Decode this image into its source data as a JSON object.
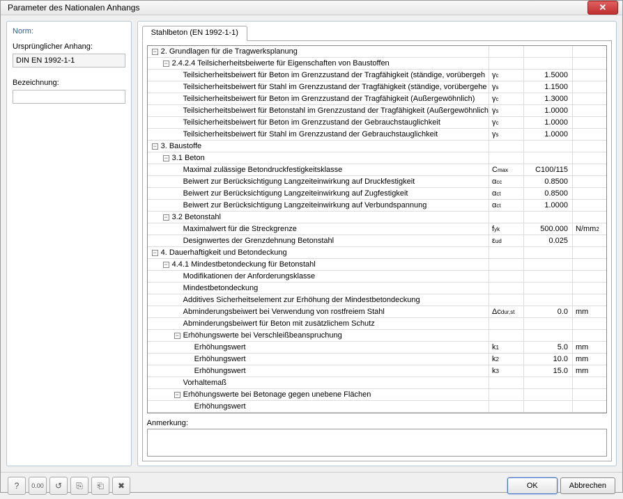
{
  "window": {
    "title": "Parameter des Nationalen Anhangs"
  },
  "left": {
    "norm_label": "Norm:",
    "ursprung_label": "Ursprünglicher Anhang:",
    "ursprung_value": "DIN EN 1992-1-1",
    "bezeichnung_label": "Bezeichnung:",
    "bezeichnung_value": ""
  },
  "tab": {
    "label": "Stahlbeton (EN 1992-1-1)"
  },
  "rows": [
    {
      "indent": 0,
      "toggle": "-",
      "desc": "2. Grundlagen für die Tragwerksplanung",
      "sym": "",
      "val": "",
      "unit": ""
    },
    {
      "indent": 1,
      "toggle": "-",
      "desc": "2.4.2.4 Teilsicherheitsbeiwerte für Eigenschaften von Baustoffen",
      "sym": "",
      "val": "",
      "unit": ""
    },
    {
      "indent": 2,
      "toggle": "",
      "desc": "Teilsicherheitsbeiwert für Beton im Grenzzustand der Tragfähigkeit (ständige, vorübergeh",
      "sym_html": "γ<sub>c</sub>",
      "val": "1.5000",
      "unit": ""
    },
    {
      "indent": 2,
      "toggle": "",
      "desc": "Teilsicherheitsbeiwert für Stahl im Grenzzustand der Tragfähigkeit (ständige, vorübergehe",
      "sym_html": "γ<sub>s</sub>",
      "val": "1.1500",
      "unit": ""
    },
    {
      "indent": 2,
      "toggle": "",
      "desc": "Teilsicherheitsbeiwert für Beton im Grenzzustand der Tragfähigkeit (Außergewöhnlich)",
      "sym_html": "γ<sub>c</sub>",
      "val": "1.3000",
      "unit": ""
    },
    {
      "indent": 2,
      "toggle": "",
      "desc": "Teilsicherheitsbeiwert für Betonstahl im Grenzzustand der Tragfähigkeit (Außergewöhnlich",
      "sym_html": "γ<sub>s</sub>",
      "val": "1.0000",
      "unit": ""
    },
    {
      "indent": 2,
      "toggle": "",
      "desc": "Teilsicherheitsbeiwert für Beton im Grenzzustand der Gebrauchstauglichkeit",
      "sym_html": "γ<sub>c</sub>",
      "val": "1.0000",
      "unit": ""
    },
    {
      "indent": 2,
      "toggle": "",
      "desc": "Teilsicherheitsbeiwert für Stahl im Grenzzustand der Gebrauchstauglichkeit",
      "sym_html": "γ<sub>s</sub>",
      "val": "1.0000",
      "unit": ""
    },
    {
      "indent": 0,
      "toggle": "-",
      "desc": "3. Baustoffe",
      "sym": "",
      "val": "",
      "unit": ""
    },
    {
      "indent": 1,
      "toggle": "-",
      "desc": "3.1 Beton",
      "sym": "",
      "val": "",
      "unit": ""
    },
    {
      "indent": 2,
      "toggle": "",
      "desc": "Maximal zulässige Betondruckfestigkeitsklasse",
      "sym_html": "C<sub>max</sub>",
      "val": "C100/115",
      "unit": ""
    },
    {
      "indent": 2,
      "toggle": "",
      "desc": "Beiwert zur Berücksichtigung Langzeiteinwirkung auf Druckfestigkeit",
      "sym_html": "α<sub>cc</sub>",
      "val": "0.8500",
      "unit": ""
    },
    {
      "indent": 2,
      "toggle": "",
      "desc": "Beiwert zur Berücksichtigung Langzeiteinwirkung auf Zugfestigkeit",
      "sym_html": "α<sub>ct</sub>",
      "val": "0.8500",
      "unit": ""
    },
    {
      "indent": 2,
      "toggle": "",
      "desc": "Beiwert zur Berücksichtigung Langzeiteinwirkung auf Verbundspannung",
      "sym_html": "α<sub>ct</sub>",
      "val": "1.0000",
      "unit": ""
    },
    {
      "indent": 1,
      "toggle": "-",
      "desc": "3.2 Betonstahl",
      "sym": "",
      "val": "",
      "unit": ""
    },
    {
      "indent": 2,
      "toggle": "",
      "desc": "Maximalwert für die Streckgrenze",
      "sym_html": "f<sub>yk</sub>",
      "val": "500.000",
      "unit_html": "N/mm<sup>2</sup>"
    },
    {
      "indent": 2,
      "toggle": "",
      "desc": "Designwertes der Grenzdehnung Betonstahl",
      "sym_html": "ε<sub>ud</sub>",
      "val": "0.025",
      "unit": ""
    },
    {
      "indent": 0,
      "toggle": "-",
      "desc": "4. Dauerhaftigkeit und Betondeckung",
      "sym": "",
      "val": "",
      "unit": ""
    },
    {
      "indent": 1,
      "toggle": "-",
      "desc": "4.4.1 Mindestbetondeckung für Betonstahl",
      "sym": "",
      "val": "",
      "unit": ""
    },
    {
      "indent": 2,
      "toggle": "",
      "desc": "Modifikationen der Anforderungsklasse",
      "sym": "",
      "val": "",
      "unit": ""
    },
    {
      "indent": 2,
      "toggle": "",
      "desc": "Mindestbetondeckung",
      "sym": "",
      "val": "",
      "unit": ""
    },
    {
      "indent": 2,
      "toggle": "",
      "desc": "Additives Sicherheitselement zur Erhöhung der Mindestbetondeckung",
      "sym": "",
      "val": "",
      "unit": ""
    },
    {
      "indent": 2,
      "toggle": "",
      "desc": "Abminderungsbeiwert bei Verwendung von rostfreiem Stahl",
      "sym_html": "Δc<sub>dur,st</sub>",
      "val": "0.0",
      "unit": "mm"
    },
    {
      "indent": 2,
      "toggle": "",
      "desc": "Abminderungsbeiwert für Beton mit zusätzlichem Schutz",
      "sym": "",
      "val": "",
      "unit": ""
    },
    {
      "indent": 2,
      "toggle": "-",
      "desc": "Erhöhungswerte bei Verschleißbeanspruchung",
      "sym": "",
      "val": "",
      "unit": ""
    },
    {
      "indent": 3,
      "toggle": "",
      "desc": "Erhöhungswert",
      "sym_html": "k<sub>1</sub>",
      "val": "5.0",
      "unit": "mm"
    },
    {
      "indent": 3,
      "toggle": "",
      "desc": "Erhöhungswert",
      "sym_html": "k<sub>2</sub>",
      "val": "10.0",
      "unit": "mm"
    },
    {
      "indent": 3,
      "toggle": "",
      "desc": "Erhöhungswert",
      "sym_html": "k<sub>3</sub>",
      "val": "15.0",
      "unit": "mm"
    },
    {
      "indent": 2,
      "toggle": "",
      "desc": "Vorhaltemaß",
      "sym": "",
      "val": "",
      "unit": ""
    },
    {
      "indent": 2,
      "toggle": "-",
      "desc": "Erhöhungswerte bei Betonage gegen unebene Flächen",
      "sym": "",
      "val": "",
      "unit": ""
    },
    {
      "indent": 3,
      "toggle": "",
      "desc": "Erhöhungswert",
      "sym": "",
      "val": "",
      "unit": ""
    }
  ],
  "remark": {
    "label": "Anmerkung:"
  },
  "footer": {
    "ok": "OK",
    "cancel": "Abbrechen"
  }
}
